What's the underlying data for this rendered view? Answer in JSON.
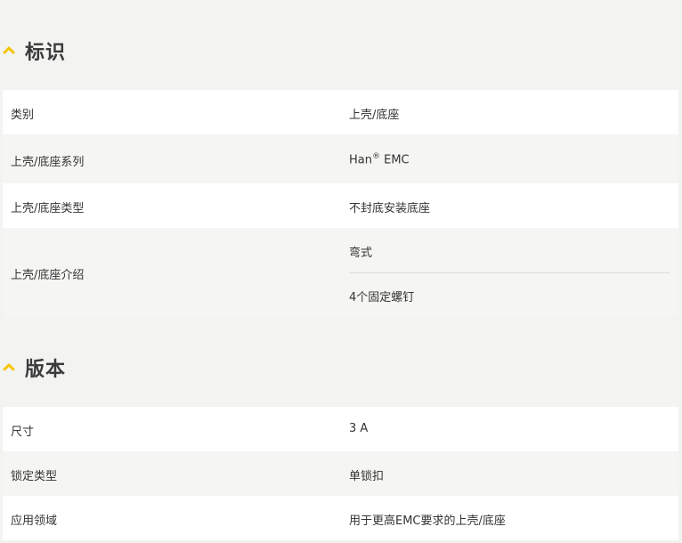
{
  "colors": {
    "accent": "#f5c400",
    "background": "#f3f3f1",
    "row_white": "#ffffff",
    "row_grey": "#f5f5f3"
  },
  "identification": {
    "title": "标识",
    "icon": "chevron-up-icon",
    "rows": [
      {
        "label": "类别",
        "value": "上壳/底座"
      },
      {
        "label": "上壳/底座系列",
        "value_main": "Han",
        "value_sup": "®",
        "value_tail": " EMC"
      },
      {
        "label": "上壳/底座类型",
        "value": "不封底安装底座"
      },
      {
        "label": "上壳/底座介绍",
        "values": [
          "弯式",
          "4个固定螺钉"
        ]
      }
    ]
  },
  "version": {
    "title": "版本",
    "icon": "chevron-up-icon",
    "rows": [
      {
        "label": "尺寸",
        "value": "3 A"
      },
      {
        "label": "锁定类型",
        "value": "单锁扣"
      },
      {
        "label": "应用领域",
        "value": "用于更高EMC要求的上壳/底座"
      }
    ]
  }
}
